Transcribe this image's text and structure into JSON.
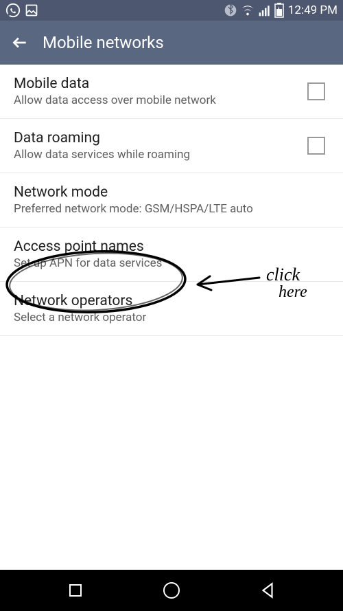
{
  "status": {
    "time": "12:49 PM"
  },
  "header": {
    "title": "Mobile networks"
  },
  "settings": [
    {
      "title": "Mobile data",
      "subtitle": "Allow data access over mobile network",
      "checkbox": true
    },
    {
      "title": "Data roaming",
      "subtitle": "Allow data services while roaming",
      "checkbox": true
    },
    {
      "title": "Network mode",
      "subtitle": "Preferred network mode: GSM/HSPA/LTE auto",
      "checkbox": false
    },
    {
      "title": "Access point names",
      "subtitle": "Set up APN for data services",
      "checkbox": false
    },
    {
      "title": "Network operators",
      "subtitle": "Select a network operator",
      "checkbox": false
    }
  ],
  "annotation": {
    "text": "click here"
  }
}
